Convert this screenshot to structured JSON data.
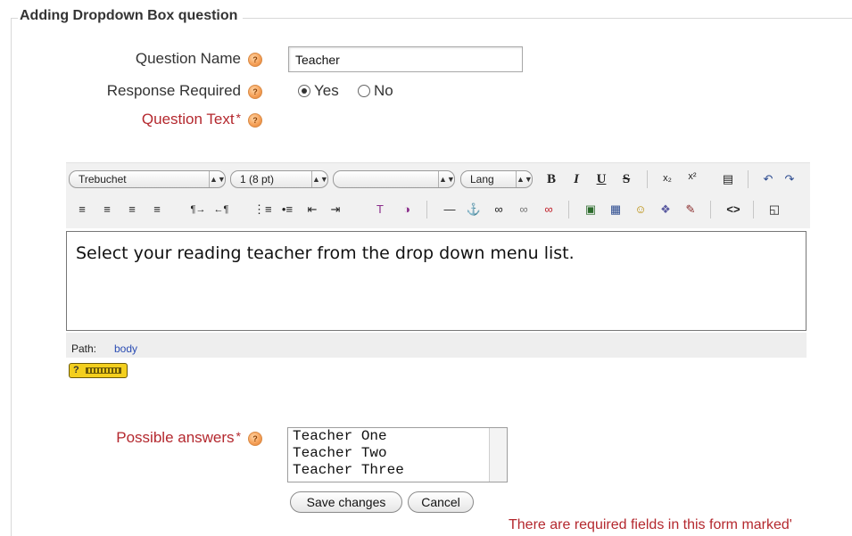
{
  "form": {
    "legend": "Adding Dropdown Box question",
    "help_icon": "help-icon",
    "question_name": {
      "label": "Question Name",
      "value": "Teacher"
    },
    "response_required": {
      "label": "Response Required",
      "options": [
        "Yes",
        "No"
      ],
      "selected": "Yes"
    },
    "question_text": {
      "label": "Question Text",
      "required_mark": "*"
    },
    "possible_answers": {
      "label": "Possible answers",
      "required_mark": "*",
      "items": [
        "Teacher One",
        "Teacher Two",
        "Teacher Three"
      ]
    },
    "buttons": {
      "save": "Save changes",
      "cancel": "Cancel"
    },
    "required_notice": "There are required fields in this form marked'"
  },
  "editor": {
    "font_family": "Trebuchet",
    "font_size": "1 (8 pt)",
    "format": "",
    "lang": "Lang",
    "content": "Select your reading teacher from the drop down menu list.",
    "path_label": "Path:",
    "path_value": "body",
    "keyboard_help": "?"
  },
  "colors": {
    "required": "#b4282e",
    "link": "#2a4cb3",
    "accent_yellow": "#f3cf1e"
  }
}
